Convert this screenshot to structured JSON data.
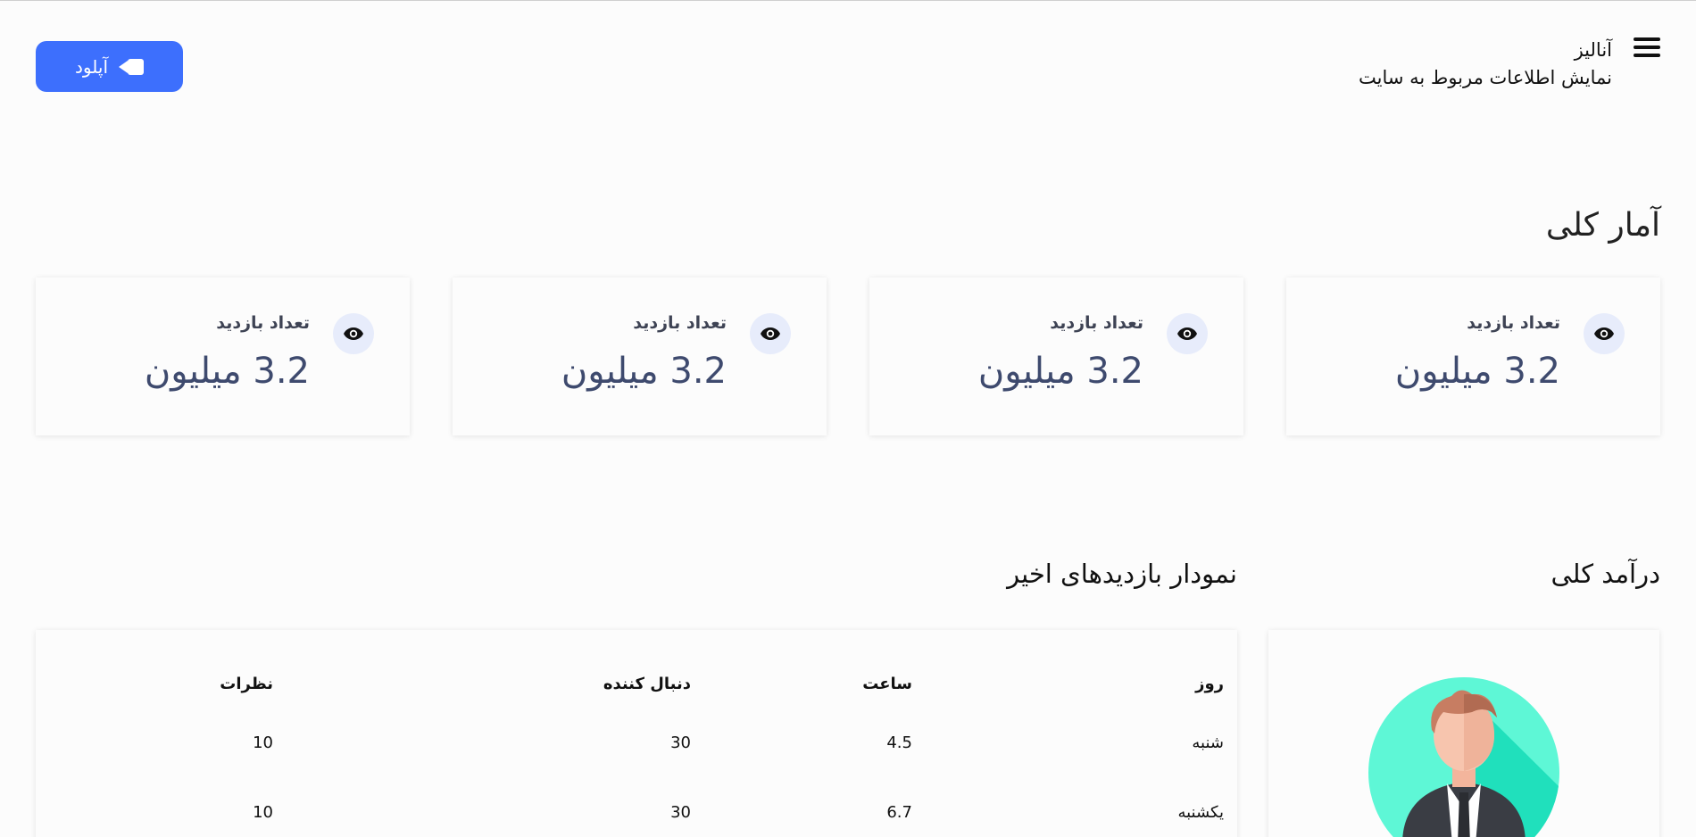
{
  "header": {
    "title": "آنالیز",
    "subtitle": "نمایش اطلاعات مربوط به سایت",
    "upload_label": "آپلود"
  },
  "overview": {
    "title": "آمار کلی",
    "cards": [
      {
        "label": "تعداد بازدید",
        "value": "3.2 میلیون"
      },
      {
        "label": "تعداد بازدید",
        "value": "3.2 میلیون"
      },
      {
        "label": "تعداد بازدید",
        "value": "3.2 میلیون"
      },
      {
        "label": "تعداد بازدید",
        "value": "3.2 میلیون"
      }
    ]
  },
  "income": {
    "title": "درآمد کلی"
  },
  "recent": {
    "title": "نمودار بازدیدهای اخیر",
    "columns": [
      "روز",
      "ساعت",
      "دنبال کننده",
      "نظرات"
    ],
    "rows": [
      [
        "شنبه",
        "4.5",
        "30",
        "10"
      ],
      [
        "یکشنبه",
        "6.7",
        "30",
        "10"
      ]
    ]
  },
  "colors": {
    "accent": "#3d6ffd",
    "icon_bg": "#e7ecfb"
  },
  "icons": [
    "menu-icon",
    "video-camera-icon",
    "eye-icon",
    "user-avatar"
  ]
}
